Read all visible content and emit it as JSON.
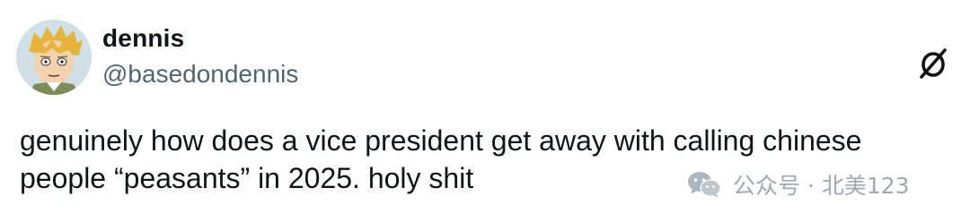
{
  "author": {
    "display_name": "dennis",
    "handle": "@basedondennis"
  },
  "tweet": {
    "lines": [
      "genuinely how does a vice president get away with calling chinese",
      "people “peasants” in 2025. holy shit"
    ]
  },
  "brand_icon": "slashed-circle-logo-icon",
  "watermark": {
    "icon": "wechat-icon",
    "text": "公众号 · 北美123"
  },
  "colors": {
    "primary_text": "#0f1419",
    "secondary_text": "#536471",
    "watermark": "#9aa4ad"
  }
}
